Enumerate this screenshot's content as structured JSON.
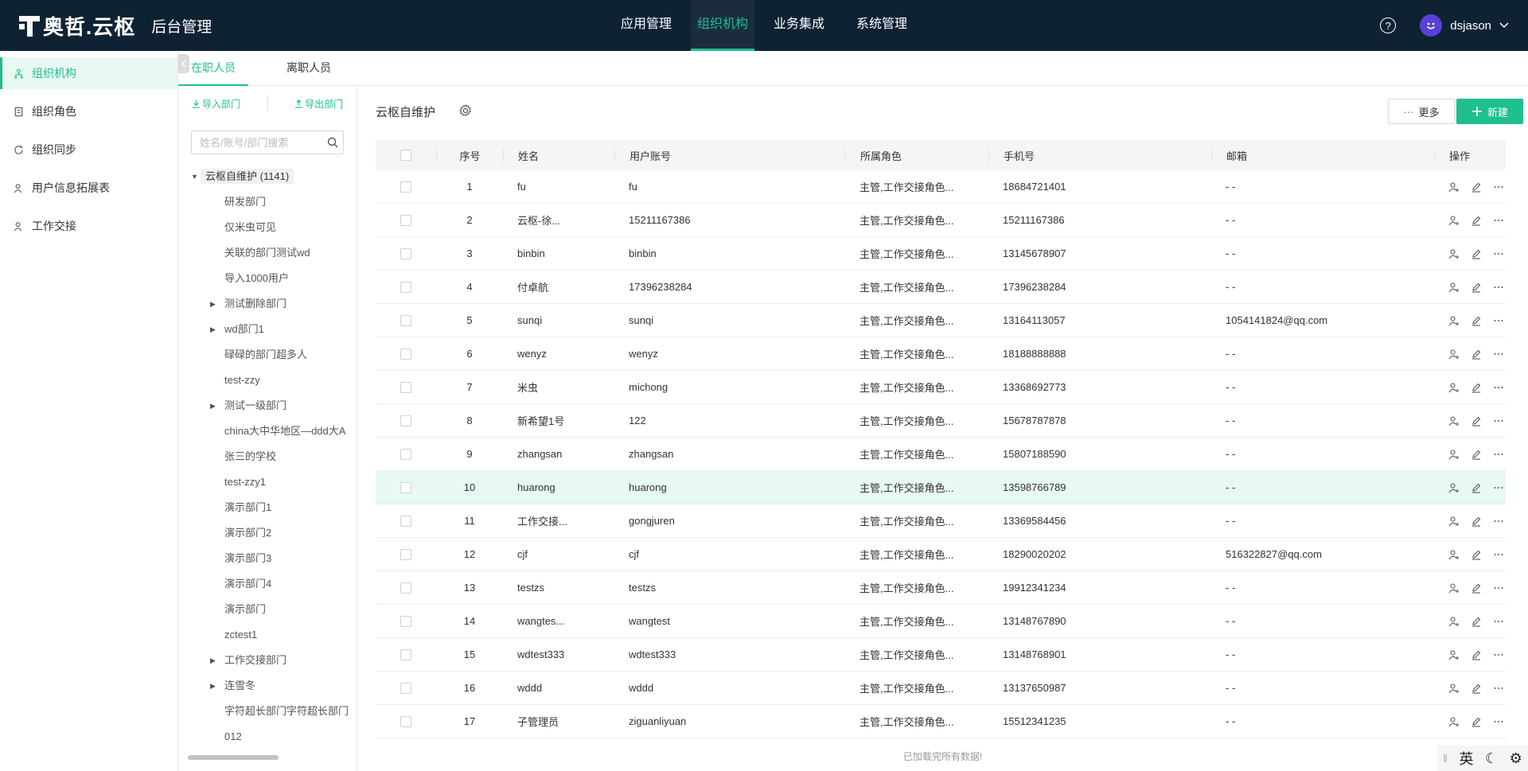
{
  "header": {
    "logo_text": "奥哲.云枢",
    "admin_title": "后台管理",
    "nav": [
      {
        "label": "应用管理",
        "active": false
      },
      {
        "label": "组织机构",
        "active": true
      },
      {
        "label": "业务集成",
        "active": false
      },
      {
        "label": "系统管理",
        "active": false
      }
    ],
    "help_label": "?",
    "username": "dsjason"
  },
  "sidebar": {
    "items": [
      {
        "label": "组织机构",
        "icon": "org-icon",
        "active": true
      },
      {
        "label": "组织角色",
        "icon": "role-icon",
        "active": false
      },
      {
        "label": "组织同步",
        "icon": "sync-icon",
        "active": false
      },
      {
        "label": "用户信息拓展表",
        "icon": "user-icon",
        "active": false
      },
      {
        "label": "工作交接",
        "icon": "handover-icon",
        "active": false
      }
    ]
  },
  "tabs": [
    {
      "label": "在职人员",
      "active": true
    },
    {
      "label": "离职人员",
      "active": false
    }
  ],
  "tree": {
    "import_label": "导入部门",
    "export_label": "导出部门",
    "search_placeholder": "姓名/账号/部门搜索",
    "root": "云枢自维护 (1141)",
    "children": [
      {
        "label": "研发部门",
        "expandable": false
      },
      {
        "label": "仅米虫可见",
        "expandable": false
      },
      {
        "label": "关联的部门测试wd",
        "expandable": false
      },
      {
        "label": "导入1000用户",
        "expandable": false
      },
      {
        "label": "测试删除部门",
        "expandable": true
      },
      {
        "label": "wd部门1",
        "expandable": true
      },
      {
        "label": "碌碌的部门超多人",
        "expandable": false
      },
      {
        "label": "test-zzy",
        "expandable": false
      },
      {
        "label": "测试一级部门",
        "expandable": true
      },
      {
        "label": "china大中华地区—ddd大A",
        "expandable": false
      },
      {
        "label": "张三的学校",
        "expandable": false
      },
      {
        "label": "test-zzy1",
        "expandable": false
      },
      {
        "label": "演示部门1",
        "expandable": false
      },
      {
        "label": "演示部门2",
        "expandable": false
      },
      {
        "label": "演示部门3",
        "expandable": false
      },
      {
        "label": "演示部门4",
        "expandable": false
      },
      {
        "label": "演示部门",
        "expandable": false
      },
      {
        "label": "zctest1",
        "expandable": false
      },
      {
        "label": "工作交接部门",
        "expandable": true
      },
      {
        "label": "连雪冬",
        "expandable": true
      },
      {
        "label": "字符超长部门字符超长部门",
        "expandable": false
      },
      {
        "label": "012",
        "expandable": false
      }
    ]
  },
  "main": {
    "title": "云枢自维护",
    "more_label": "更多",
    "new_label": "新建",
    "columns": [
      "序号",
      "姓名",
      "用户账号",
      "所属角色",
      "手机号",
      "邮箱",
      "操作"
    ],
    "rows": [
      {
        "idx": "1",
        "name": "fu",
        "account": "fu",
        "role": "主管,工作交接角色...",
        "phone": "18684721401",
        "email": "- -"
      },
      {
        "idx": "2",
        "name": "云枢-徐...",
        "account": "15211167386",
        "role": "主管,工作交接角色...",
        "phone": "15211167386",
        "email": "- -"
      },
      {
        "idx": "3",
        "name": "binbin",
        "account": "binbin",
        "role": "主管,工作交接角色...",
        "phone": "13145678907",
        "email": "- -"
      },
      {
        "idx": "4",
        "name": "付卓航",
        "account": "17396238284",
        "role": "主管,工作交接角色...",
        "phone": "17396238284",
        "email": "- -"
      },
      {
        "idx": "5",
        "name": "sunqi",
        "account": "sunqi",
        "role": "主管,工作交接角色...",
        "phone": "13164113057",
        "email": "1054141824@qq.com"
      },
      {
        "idx": "6",
        "name": "wenyz",
        "account": "wenyz",
        "role": "主管,工作交接角色...",
        "phone": "18188888888",
        "email": "- -"
      },
      {
        "idx": "7",
        "name": "米虫",
        "account": "michong",
        "role": "主管,工作交接角色...",
        "phone": "13368692773",
        "email": "- -"
      },
      {
        "idx": "8",
        "name": "新希望1号",
        "account": "122",
        "role": "主管,工作交接角色...",
        "phone": "15678787878",
        "email": "- -"
      },
      {
        "idx": "9",
        "name": "zhangsan",
        "account": "zhangsan",
        "role": "主管,工作交接角色...",
        "phone": "15807188590",
        "email": "- -"
      },
      {
        "idx": "10",
        "name": "huarong",
        "account": "huarong",
        "role": "主管,工作交接角色...",
        "phone": "13598766789",
        "email": "- -"
      },
      {
        "idx": "11",
        "name": "工作交接...",
        "account": "gongjuren",
        "role": "主管,工作交接角色...",
        "phone": "13369584456",
        "email": "- -"
      },
      {
        "idx": "12",
        "name": "cjf",
        "account": "cjf",
        "role": "主管,工作交接角色...",
        "phone": "18290020202",
        "email": "516322827@qq.com"
      },
      {
        "idx": "13",
        "name": "testzs",
        "account": "testzs",
        "role": "主管,工作交接角色...",
        "phone": "19912341234",
        "email": "- -"
      },
      {
        "idx": "14",
        "name": "wangtes...",
        "account": "wangtest",
        "role": "主管,工作交接角色...",
        "phone": "13148767890",
        "email": "- -"
      },
      {
        "idx": "15",
        "name": "wdtest333",
        "account": "wdtest333",
        "role": "主管,工作交接角色...",
        "phone": "13148768901",
        "email": "- -"
      },
      {
        "idx": "16",
        "name": "wddd",
        "account": "wddd",
        "role": "主管,工作交接角色...",
        "phone": "13137650987",
        "email": "- -"
      },
      {
        "idx": "17",
        "name": "子管理员",
        "account": "ziguanliyuan",
        "role": "主管,工作交接角色...",
        "phone": "15512341235",
        "email": "- -"
      }
    ],
    "highlight_row": "10",
    "load_tip": "已加载完所有数据!"
  },
  "ime": {
    "lang": "英",
    "moon": "☾",
    "gear": "⚙"
  },
  "colors": {
    "topbar": "#0f2233",
    "accent": "#1fbf8f",
    "avatar": "#5b3fd9"
  }
}
